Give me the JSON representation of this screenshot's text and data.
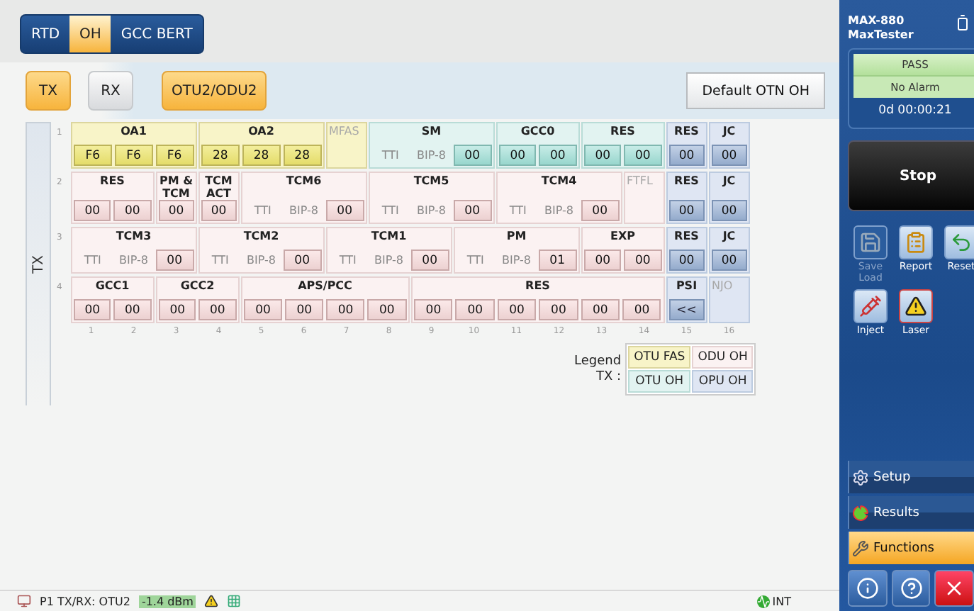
{
  "tabs": [
    {
      "label": "RTD",
      "selected": false
    },
    {
      "label": "OH",
      "selected": true
    },
    {
      "label": "GCC BERT",
      "selected": false
    }
  ],
  "direction_tabs": [
    {
      "label": "TX",
      "selected": true
    },
    {
      "label": "RX",
      "selected": false
    }
  ],
  "signal_button": "OTU2/ODU2",
  "default_button": "Default OTN OH",
  "side_label": "TX",
  "rows": [
    {
      "number": "1",
      "groups": [
        {
          "title": "OA1",
          "kind": "fas",
          "disabled": false,
          "items": [
            {
              "kind": "byte",
              "text": "F6"
            },
            {
              "kind": "byte",
              "text": "F6"
            },
            {
              "kind": "byte",
              "text": "F6"
            }
          ]
        },
        {
          "title": "OA2",
          "kind": "fas",
          "disabled": false,
          "items": [
            {
              "kind": "byte",
              "text": "28"
            },
            {
              "kind": "byte",
              "text": "28"
            },
            {
              "kind": "byte",
              "text": "28"
            }
          ]
        },
        {
          "title": "MFAS",
          "kind": "fas",
          "disabled": true
        },
        {
          "title": "SM",
          "kind": "otu",
          "disabled": false,
          "items": [
            {
              "kind": "label",
              "text": "TTI"
            },
            {
              "kind": "label",
              "text": "BIP-8"
            },
            {
              "kind": "byte",
              "text": "00"
            }
          ]
        },
        {
          "title": "GCC0",
          "kind": "otu",
          "disabled": false,
          "items": [
            {
              "kind": "byte",
              "text": "00"
            },
            {
              "kind": "byte",
              "text": "00"
            }
          ]
        },
        {
          "title": "RES",
          "kind": "otu",
          "disabled": false,
          "items": [
            {
              "kind": "byte",
              "text": "00"
            },
            {
              "kind": "byte",
              "text": "00"
            }
          ]
        },
        {
          "title": "RES",
          "kind": "opu",
          "disabled": false,
          "items": [
            {
              "kind": "byte",
              "text": "00"
            }
          ]
        },
        {
          "title": "JC",
          "kind": "opu",
          "disabled": false,
          "items": [
            {
              "kind": "byte",
              "text": "00"
            }
          ]
        }
      ]
    },
    {
      "number": "2",
      "groups": [
        {
          "title": "RES",
          "kind": "odu",
          "disabled": false,
          "items": [
            {
              "kind": "byte",
              "text": "00"
            },
            {
              "kind": "byte",
              "text": "00"
            }
          ]
        },
        {
          "title": "PM & TCM",
          "kind": "odu",
          "disabled": false,
          "items": [
            {
              "kind": "byte",
              "text": "00"
            }
          ]
        },
        {
          "title": "TCM ACT",
          "kind": "odu",
          "disabled": false,
          "items": [
            {
              "kind": "byte",
              "text": "00"
            }
          ]
        },
        {
          "title": "TCM6",
          "kind": "odu",
          "disabled": false,
          "items": [
            {
              "kind": "label",
              "text": "TTI"
            },
            {
              "kind": "label",
              "text": "BIP-8"
            },
            {
              "kind": "byte",
              "text": "00"
            }
          ]
        },
        {
          "title": "TCM5",
          "kind": "odu",
          "disabled": false,
          "items": [
            {
              "kind": "label",
              "text": "TTI"
            },
            {
              "kind": "label",
              "text": "BIP-8"
            },
            {
              "kind": "byte",
              "text": "00"
            }
          ]
        },
        {
          "title": "TCM4",
          "kind": "odu",
          "disabled": false,
          "items": [
            {
              "kind": "label",
              "text": "TTI"
            },
            {
              "kind": "label",
              "text": "BIP-8"
            },
            {
              "kind": "byte",
              "text": "00"
            }
          ]
        },
        {
          "title": "FTFL",
          "kind": "odu",
          "disabled": true
        },
        {
          "title": "RES",
          "kind": "opu",
          "disabled": false,
          "items": [
            {
              "kind": "byte",
              "text": "00"
            }
          ]
        },
        {
          "title": "JC",
          "kind": "opu",
          "disabled": false,
          "items": [
            {
              "kind": "byte",
              "text": "00"
            }
          ]
        }
      ]
    },
    {
      "number": "3",
      "groups": [
        {
          "title": "TCM3",
          "kind": "odu",
          "disabled": false,
          "items": [
            {
              "kind": "label",
              "text": "TTI"
            },
            {
              "kind": "label",
              "text": "BIP-8"
            },
            {
              "kind": "byte",
              "text": "00"
            }
          ]
        },
        {
          "title": "TCM2",
          "kind": "odu",
          "disabled": false,
          "items": [
            {
              "kind": "label",
              "text": "TTI"
            },
            {
              "kind": "label",
              "text": "BIP-8"
            },
            {
              "kind": "byte",
              "text": "00"
            }
          ]
        },
        {
          "title": "TCM1",
          "kind": "odu",
          "disabled": false,
          "items": [
            {
              "kind": "label",
              "text": "TTI"
            },
            {
              "kind": "label",
              "text": "BIP-8"
            },
            {
              "kind": "byte",
              "text": "00"
            }
          ]
        },
        {
          "title": "PM",
          "kind": "odu",
          "disabled": false,
          "items": [
            {
              "kind": "label",
              "text": "TTI"
            },
            {
              "kind": "label",
              "text": "BIP-8"
            },
            {
              "kind": "byte",
              "text": "01"
            }
          ]
        },
        {
          "title": "EXP",
          "kind": "odu",
          "disabled": false,
          "items": [
            {
              "kind": "byte",
              "text": "00"
            },
            {
              "kind": "byte",
              "text": "00"
            }
          ]
        },
        {
          "title": "RES",
          "kind": "opu",
          "disabled": false,
          "items": [
            {
              "kind": "byte",
              "text": "00"
            }
          ]
        },
        {
          "title": "JC",
          "kind": "opu",
          "disabled": false,
          "items": [
            {
              "kind": "byte",
              "text": "00"
            }
          ]
        }
      ]
    },
    {
      "number": "4",
      "groups": [
        {
          "title": "GCC1",
          "kind": "odu",
          "disabled": false,
          "items": [
            {
              "kind": "byte",
              "text": "00"
            },
            {
              "kind": "byte",
              "text": "00"
            }
          ]
        },
        {
          "title": "GCC2",
          "kind": "odu",
          "disabled": false,
          "items": [
            {
              "kind": "byte",
              "text": "00"
            },
            {
              "kind": "byte",
              "text": "00"
            }
          ]
        },
        {
          "title": "APS/PCC",
          "kind": "odu",
          "disabled": false,
          "items": [
            {
              "kind": "byte",
              "text": "00"
            },
            {
              "kind": "byte",
              "text": "00"
            },
            {
              "kind": "byte",
              "text": "00"
            },
            {
              "kind": "byte",
              "text": "00"
            }
          ]
        },
        {
          "title": "RES",
          "kind": "odu",
          "disabled": false,
          "items": [
            {
              "kind": "byte",
              "text": "00"
            },
            {
              "kind": "byte",
              "text": "00"
            },
            {
              "kind": "byte",
              "text": "00"
            },
            {
              "kind": "byte",
              "text": "00"
            },
            {
              "kind": "byte",
              "text": "00"
            },
            {
              "kind": "byte",
              "text": "00"
            }
          ]
        },
        {
          "title": "PSI",
          "kind": "opu",
          "disabled": false,
          "items": [
            {
              "kind": "button",
              "text": "<<"
            }
          ]
        },
        {
          "title": "NJO",
          "kind": "opu",
          "disabled": true
        }
      ]
    }
  ],
  "column_numbers": [
    "1",
    "2",
    "3",
    "4",
    "5",
    "6",
    "7",
    "8",
    "9",
    "10",
    "11",
    "12",
    "13",
    "14",
    "15",
    "16"
  ],
  "legend": {
    "title": "Legend",
    "subtitle": "TX :",
    "items": [
      {
        "label": "OTU FAS",
        "kind": "fas"
      },
      {
        "label": "ODU OH",
        "kind": "odu"
      },
      {
        "label": "OTU OH",
        "kind": "otu"
      },
      {
        "label": "OPU OH",
        "kind": "opu"
      }
    ]
  },
  "device": {
    "model": "MAX-880",
    "name": "MaxTester"
  },
  "status": {
    "verdict": "PASS",
    "alarm": "No Alarm",
    "timer": "0d 00:00:21"
  },
  "stop_button": "Stop",
  "tools": [
    {
      "label": "Save Load",
      "kind": "save",
      "disabled": true
    },
    {
      "label": "Report",
      "kind": "report",
      "disabled": false
    },
    {
      "label": "Reset",
      "kind": "reset",
      "disabled": false
    },
    {
      "label": "Inject",
      "kind": "inject",
      "disabled": false
    },
    {
      "label": "Laser",
      "kind": "laser",
      "disabled": false
    }
  ],
  "nav": [
    {
      "label": "Setup",
      "kind": "setup",
      "selected": false
    },
    {
      "label": "Results",
      "kind": "results",
      "selected": false
    },
    {
      "label": "Functions",
      "kind": "functions",
      "selected": true
    }
  ],
  "status_bar": {
    "port": "P1 TX/RX: OTU2",
    "power": "-1.4 dBm",
    "clock": "INT"
  }
}
